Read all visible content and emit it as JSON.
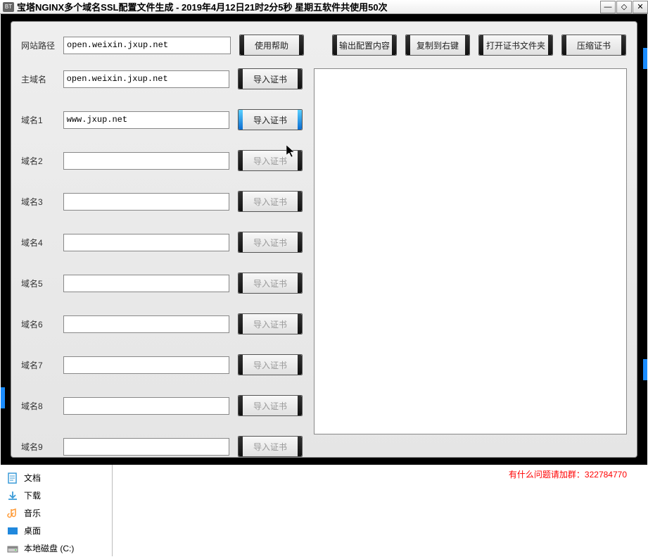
{
  "window": {
    "icon_text": "BT",
    "title": "宝塔NGINX多个域名SSL配置文件生成 - 2019年4月12日21时2分5秒 星期五软件共使用50次"
  },
  "toolbar": {
    "site_path_label": "网站路径",
    "site_path_value": "open.weixin.jxup.net",
    "help_btn": "使用帮助",
    "output_config_btn": "输出配置内容",
    "copy_right_btn": "复制到右键",
    "open_cert_folder_btn": "打开证书文件夹",
    "compress_cert_btn": "压缩证书"
  },
  "main_domain": {
    "label": "主域名",
    "value": "open.weixin.jxup.net",
    "import_btn": "导入证书"
  },
  "domains": [
    {
      "label": "域名1",
      "value": "www.jxup.net",
      "btn": "导入证书",
      "active": true,
      "enabled": true
    },
    {
      "label": "域名2",
      "value": "",
      "btn": "导入证书",
      "active": false,
      "enabled": false
    },
    {
      "label": "域名3",
      "value": "",
      "btn": "导入证书",
      "active": false,
      "enabled": false
    },
    {
      "label": "域名4",
      "value": "",
      "btn": "导入证书",
      "active": false,
      "enabled": false
    },
    {
      "label": "域名5",
      "value": "",
      "btn": "导入证书",
      "active": false,
      "enabled": false
    },
    {
      "label": "域名6",
      "value": "",
      "btn": "导入证书",
      "active": false,
      "enabled": false
    },
    {
      "label": "域名7",
      "value": "",
      "btn": "导入证书",
      "active": false,
      "enabled": false
    },
    {
      "label": "域名8",
      "value": "",
      "btn": "导入证书",
      "active": false,
      "enabled": false
    },
    {
      "label": "域名9",
      "value": "",
      "btn": "导入证书",
      "active": false,
      "enabled": false
    }
  ],
  "footer": {
    "usage": "软件共使用50次",
    "contact": "有什么问题请加群：322784770"
  },
  "sidebar": {
    "items": [
      {
        "icon_color": "#3a9bd8",
        "label": "文档"
      },
      {
        "icon_color": "#3a9bd8",
        "label": "下载"
      },
      {
        "icon_color": "#ff9933",
        "label": "音乐"
      },
      {
        "icon_color": "#2088dd",
        "label": "桌面"
      },
      {
        "icon_color": "#888",
        "label": "本地磁盘 (C:)"
      }
    ]
  }
}
